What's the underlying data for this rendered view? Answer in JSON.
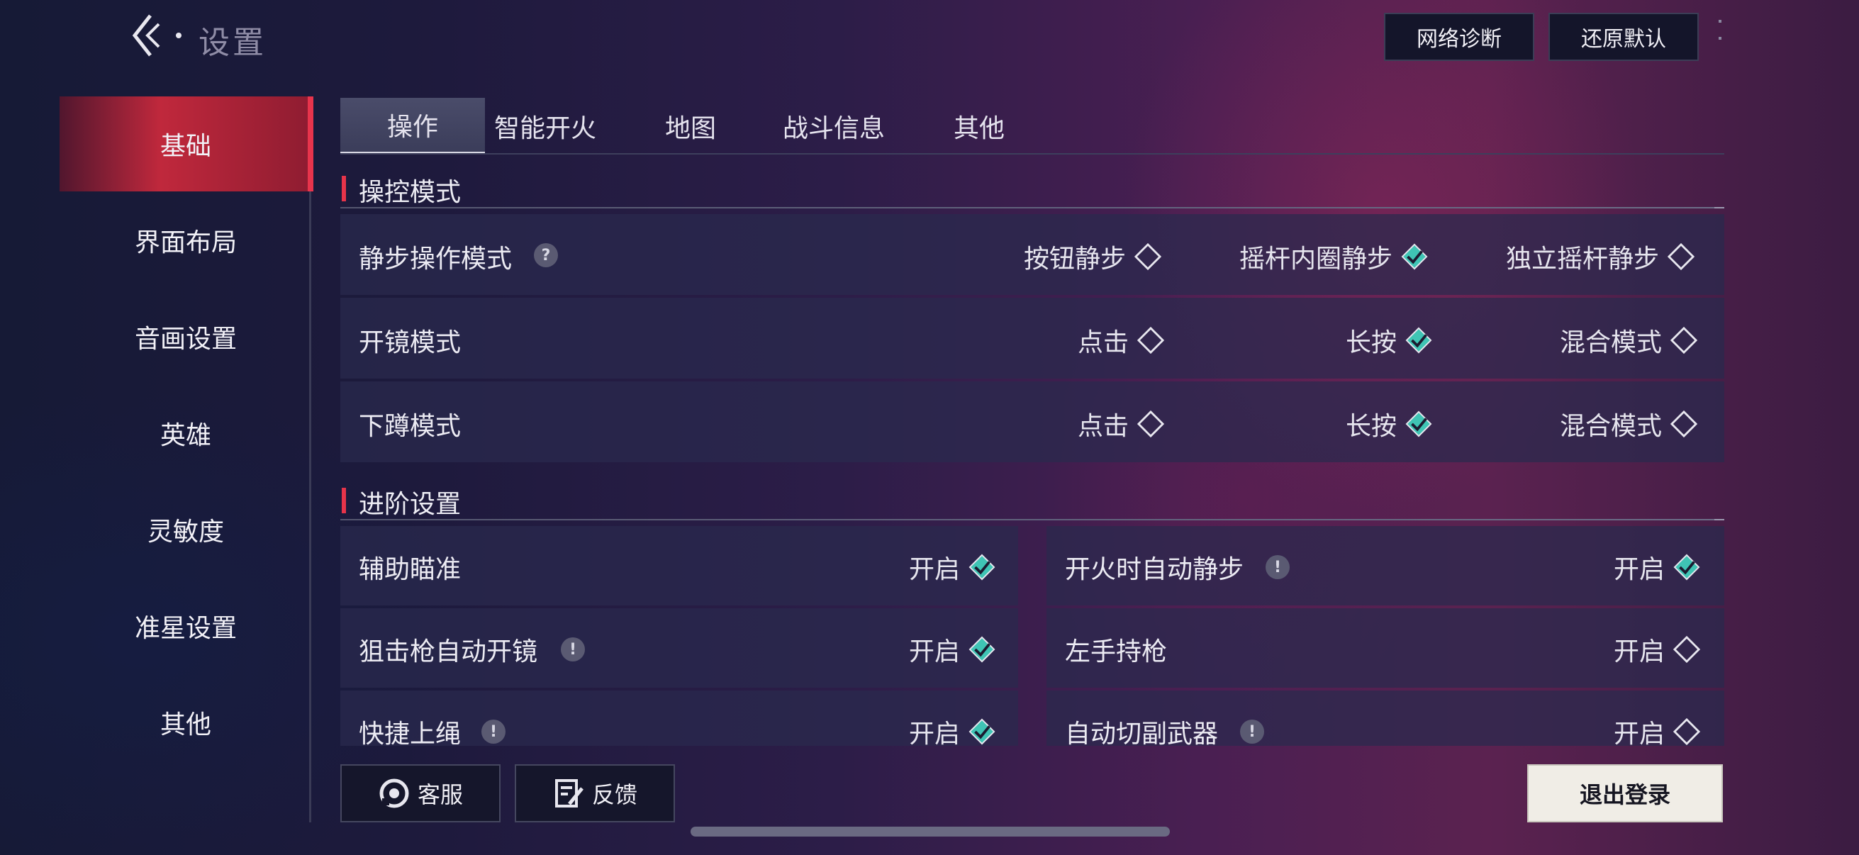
{
  "header": {
    "title": "设置",
    "network_button": "网络诊断",
    "reset_button": "还原默认"
  },
  "sidebar": {
    "items": [
      {
        "label": "基础",
        "active": true
      },
      {
        "label": "界面布局"
      },
      {
        "label": "音画设置"
      },
      {
        "label": "英雄"
      },
      {
        "label": "灵敏度"
      },
      {
        "label": "准星设置"
      },
      {
        "label": "其他"
      }
    ]
  },
  "tabs": [
    {
      "label": "操作",
      "active": true
    },
    {
      "label": "智能开火"
    },
    {
      "label": "地图"
    },
    {
      "label": "战斗信息"
    },
    {
      "label": "其他"
    }
  ],
  "control_section": {
    "title": "操控模式",
    "rows": [
      {
        "label": "静步操作模式",
        "help": "?",
        "options": [
          {
            "label": "按钮静步",
            "checked": false
          },
          {
            "label": "摇杆内圈静步",
            "checked": true
          },
          {
            "label": "独立摇杆静步",
            "checked": false
          }
        ]
      },
      {
        "label": "开镜模式",
        "options": [
          {
            "label": "点击",
            "checked": false
          },
          {
            "label": "长按",
            "checked": true
          },
          {
            "label": "混合模式",
            "checked": false
          }
        ]
      },
      {
        "label": "下蹲模式",
        "options": [
          {
            "label": "点击",
            "checked": false
          },
          {
            "label": "长按",
            "checked": true
          },
          {
            "label": "混合模式",
            "checked": false
          }
        ]
      }
    ]
  },
  "advanced_section": {
    "title": "进阶设置",
    "left": [
      {
        "label": "辅助瞄准",
        "value": "开启",
        "checked": true
      },
      {
        "label": "狙击枪自动开镜",
        "info": "!",
        "value": "开启",
        "checked": true
      },
      {
        "label": "快捷上绳",
        "info": "!",
        "value": "开启",
        "checked": true
      }
    ],
    "right": [
      {
        "label": "开火时自动静步",
        "info": "!",
        "value": "开启",
        "checked": true
      },
      {
        "label": "左手持枪",
        "value": "开启",
        "checked": false
      },
      {
        "label": "自动切副武器",
        "info": "!",
        "value": "开启",
        "checked": false
      }
    ]
  },
  "footer": {
    "service_button": "客服",
    "feedback_button": "反馈",
    "logout_button": "退出登录"
  },
  "colors": {
    "accent_red": "#e6344a",
    "check_teal": "#3fc4b4"
  }
}
